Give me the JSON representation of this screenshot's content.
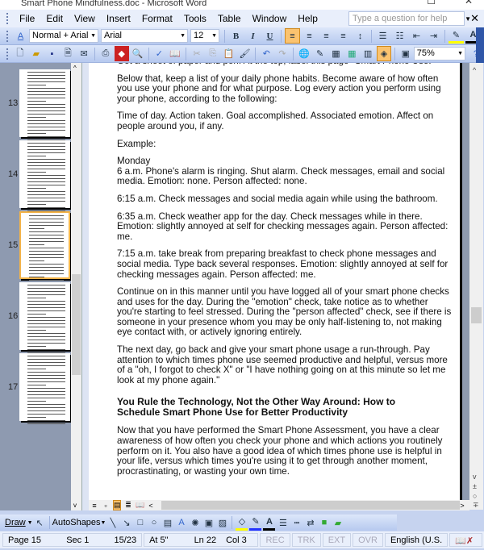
{
  "window": {
    "title": "Smart Phone Mindfulness.doc - Microsoft Word"
  },
  "menu": {
    "items": [
      "File",
      "Edit",
      "View",
      "Insert",
      "Format",
      "Tools",
      "Table",
      "Window",
      "Help"
    ],
    "help_placeholder": "Type a question for help"
  },
  "formatting": {
    "style": "Normal + Arial",
    "font": "Arial",
    "size": "12",
    "bold": "B",
    "italic": "I",
    "underline": "U"
  },
  "standard": {
    "zoom": "75%"
  },
  "thumbnails": [
    {
      "page": "13"
    },
    {
      "page": "14"
    },
    {
      "page": "15",
      "selected": true
    },
    {
      "page": "16"
    },
    {
      "page": "17"
    }
  ],
  "document": {
    "paragraphs": [
      [
        "Get a sheet of paper and pen. At the top, label this page \"Smart Phone Use.\""
      ],
      [
        "Below that, keep a list of your daily phone habits. Become aware of how often",
        "you use your phone and for what purpose. Log every action you perform using",
        "your phone, according to the following:"
      ],
      [
        "Time of day. Action taken. Goal accomplished. Associated emotion. Affect on",
        "people around you, if any."
      ],
      [
        "Example:"
      ],
      [
        "Monday",
        "6 a.m. Phone's alarm is ringing. Shut alarm. Check messages, email and social",
        "media. Emotion: none. Person affected: none."
      ],
      [
        "6:15 a.m. Check messages and social media again while using the bathroom."
      ],
      [
        "6:35 a.m. Check weather app for the day. Check messages while in there.",
        "Emotion: slightly annoyed at self for checking messages again. Person affected:",
        "me."
      ],
      [
        "7:15 a.m. take break from preparing breakfast to check phone messages and",
        "social media. Type back several responses. Emotion: slightly annoyed at self for",
        "checking messages again. Person affected: me."
      ],
      [
        "Continue on in this manner until you have logged all of your smart phone checks",
        "and uses for the day. During the \"emotion\" check, take notice as to whether",
        "you're starting to feel stressed. During the \"person affected\" check, see if there is",
        "someone in your presence whom you may be only half-listening to, not making",
        "eye contact with, or actively ignoring entirely."
      ],
      [
        "The next day, go back and give your smart phone usage a run-through. Pay",
        "attention to which times phone use seemed productive and helpful, versus more",
        "of a \"oh, I forgot to check X\" or \"I have nothing going on at this minute so let me",
        "look at my phone again.\""
      ]
    ],
    "heading": [
      "You Rule the Technology, Not the Other Way Around: How to",
      "Schedule Smart Phone Use for Better Productivity"
    ],
    "last_paragraph": [
      "Now that you have performed the Smart Phone Assessment, you have a clear",
      "awareness of how often you check your phone and which actions you routinely",
      "perform on it. You also have a good idea of which times phone use is helpful in",
      "your life, versus which times you're using it to get through another moment,",
      "procrastinating, or wasting your own time."
    ]
  },
  "drawing": {
    "draw": "Draw",
    "autoshapes": "AutoShapes"
  },
  "status": {
    "page": "Page 15",
    "sec": "Sec 1",
    "pages": "15/23",
    "at": "At 5\"",
    "ln": "Ln 22",
    "col": "Col 3",
    "rec": "REC",
    "trk": "TRK",
    "ext": "EXT",
    "ovr": "OVR",
    "language": "English (U.S."
  }
}
